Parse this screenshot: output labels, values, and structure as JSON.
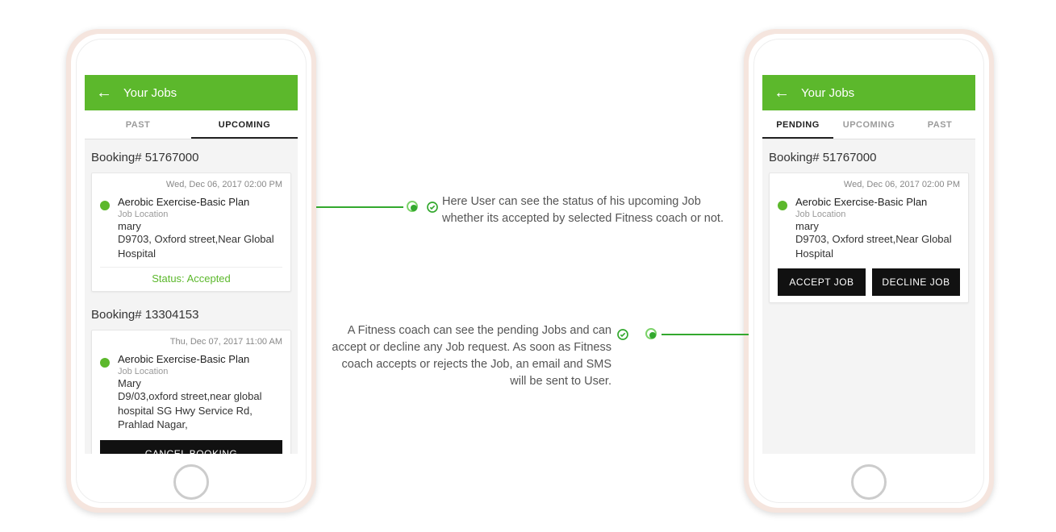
{
  "phone_left": {
    "appbar": {
      "title": "Your Jobs"
    },
    "tabs": [
      {
        "label": "PAST",
        "active": false
      },
      {
        "label": "UPCOMING",
        "active": true
      }
    ],
    "booking1": {
      "header": "Booking# 51767000",
      "date": "Wed, Dec 06, 2017 02:00 PM",
      "plan": "Aerobic Exercise-Basic Plan",
      "loc_label": "Job Location",
      "name": "mary",
      "address": "D9703, Oxford street,Near Global Hospital",
      "status": "Status: Accepted"
    },
    "booking2": {
      "header": "Booking# 13304153",
      "date": "Thu, Dec 07, 2017 11:00 AM",
      "plan": "Aerobic Exercise-Basic Plan",
      "loc_label": "Job Location",
      "name": "Mary",
      "address": "D9/03,oxford street,near global hospital SG Hwy Service Rd, Prahlad Nagar,",
      "cancel_label": "CANCEL BOOKING"
    }
  },
  "phone_right": {
    "appbar": {
      "title": "Your Jobs"
    },
    "tabs": [
      {
        "label": "PENDING",
        "active": true
      },
      {
        "label": "UPCOMING",
        "active": false
      },
      {
        "label": "PAST",
        "active": false
      }
    ],
    "booking": {
      "header": "Booking# 51767000",
      "date": "Wed, Dec 06, 2017 02:00 PM",
      "plan": "Aerobic Exercise-Basic Plan",
      "loc_label": "Job Location",
      "name": "mary",
      "address": "D9703, Oxford street,Near Global Hospital",
      "accept_label": "ACCEPT JOB",
      "decline_label": "DECLINE JOB"
    }
  },
  "annotations": {
    "ann1": "Here User can see the status of his upcoming Job whether its accepted by selected Fitness coach or not.",
    "ann2": "A Fitness coach can see the pending Jobs and can accept or decline any Job request. As soon as Fitness coach accepts or rejects the Job, an email and SMS will be sent to User."
  }
}
